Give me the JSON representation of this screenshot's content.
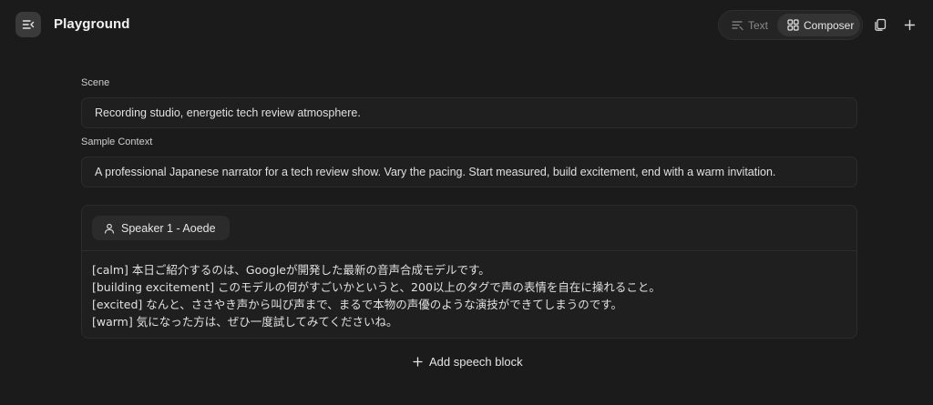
{
  "header": {
    "title": "Playground",
    "modes": [
      {
        "label": "Text",
        "active": false
      },
      {
        "label": "Composer",
        "active": true
      }
    ]
  },
  "scene": {
    "label": "Scene",
    "value": "Recording studio, energetic tech review atmosphere."
  },
  "sample_context": {
    "label": "Sample Context",
    "value": "A professional Japanese narrator for a tech review show. Vary the pacing. Start measured, build excitement, end with a warm invitation."
  },
  "speech_block": {
    "speaker": "Speaker 1 - Aoede",
    "lines": [
      "[calm] 本日ご紹介するのは、Googleが開発した最新の音声合成モデルです。",
      "[building excitement] このモデルの何がすごいかというと、200以上のタグで声の表情を自在に操れること。",
      "[excited] なんと、ささやき声から叫び声まで、まるで本物の声優のような演技ができてしまうのです。",
      "[warm] 気になった方は、ぜひ一度試してみてくださいね。"
    ]
  },
  "add_block": {
    "label": "Add speech block"
  },
  "colors": {
    "background": "#1b1b1b",
    "surface": "#1f1f1f",
    "border": "#2c2c2c",
    "text": "#e6e6e6",
    "muted": "#8a8a8a"
  }
}
